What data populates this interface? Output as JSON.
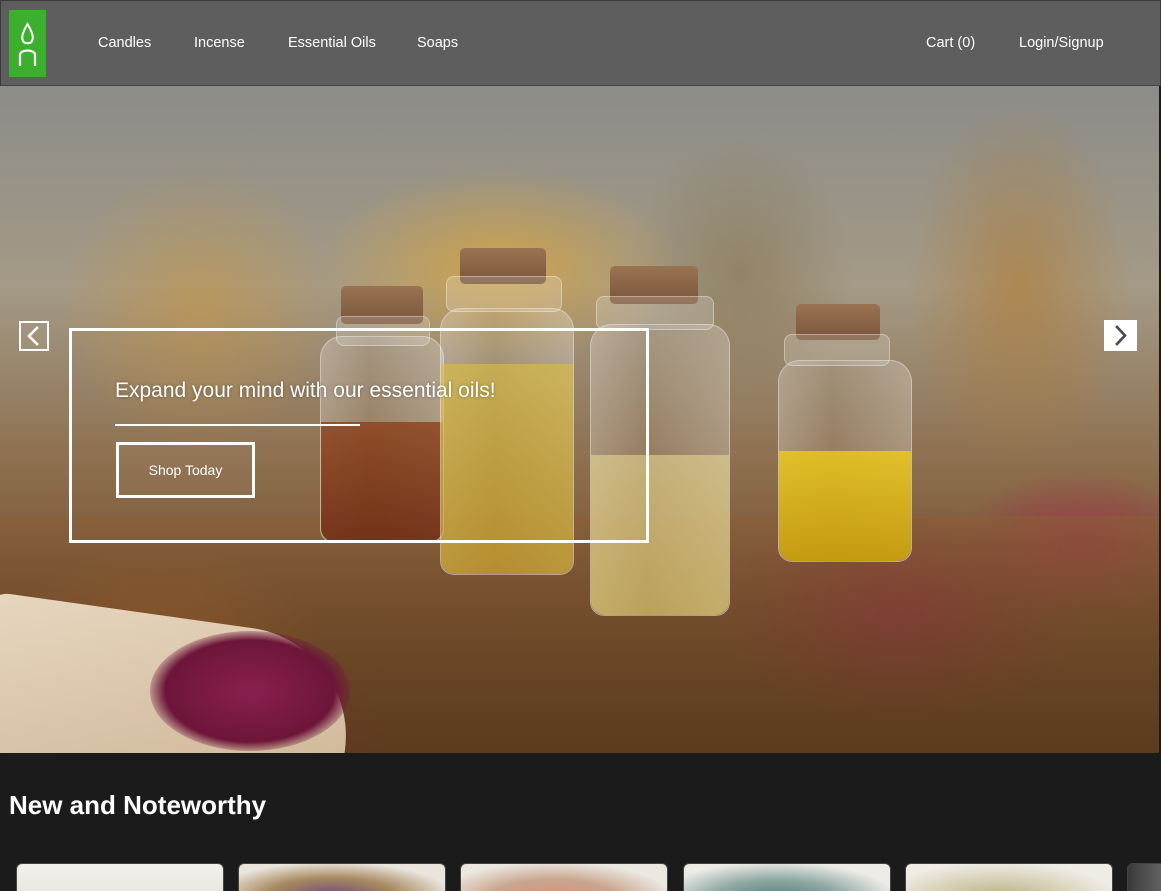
{
  "nav": {
    "logo_icon": "candle-flame-logo",
    "links": [
      "Candles",
      "Incense",
      "Essential Oils",
      "Soaps"
    ],
    "cart_label": "Cart (0)",
    "login_label": "Login/Signup",
    "logo_color": "#3daf2f",
    "bar_color": "#5e5e5e"
  },
  "hero": {
    "headline": "Expand your mind with our essential oils!",
    "cta_label": "Shop Today",
    "prev_icon": "chevron-left-icon",
    "next_icon": "chevron-right-icon"
  },
  "section": {
    "title": "New and Noteworthy",
    "products": [
      {
        "thumb": "white-candle"
      },
      {
        "thumb": "dried-flowers"
      },
      {
        "thumb": "pink-soap"
      },
      {
        "thumb": "teal-soap"
      },
      {
        "thumb": "cream-soap"
      }
    ]
  },
  "theme": {
    "page_bg": "#1b1b1b",
    "text": "#ffffff"
  }
}
